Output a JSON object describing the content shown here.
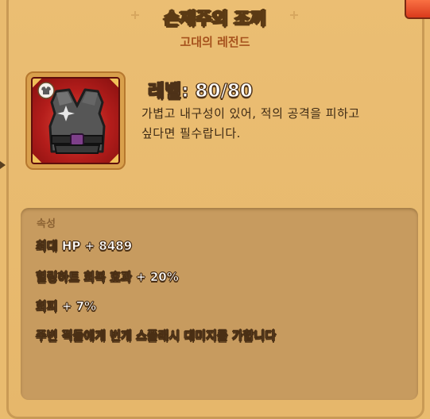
{
  "item": {
    "name": "손재주의 조끼",
    "rarity": "고대의 레전드",
    "level": "레벨: 80/80",
    "description_lines": [
      "가볍고 내구성이 있어, 적의 공격을 피하고",
      "싶다면 필수랍니다."
    ],
    "icon": "vest-icon",
    "slot_icon": "armor-slot-icon",
    "frame_color": "#c52520"
  },
  "attributes": {
    "header": "속성",
    "lines": [
      "최대 HP + 8489",
      "힐링하트 회복 효과 + 20%",
      "회피 + 7%",
      "주변 적들에게 번개 스플래시 대미지를 가합니다"
    ]
  }
}
